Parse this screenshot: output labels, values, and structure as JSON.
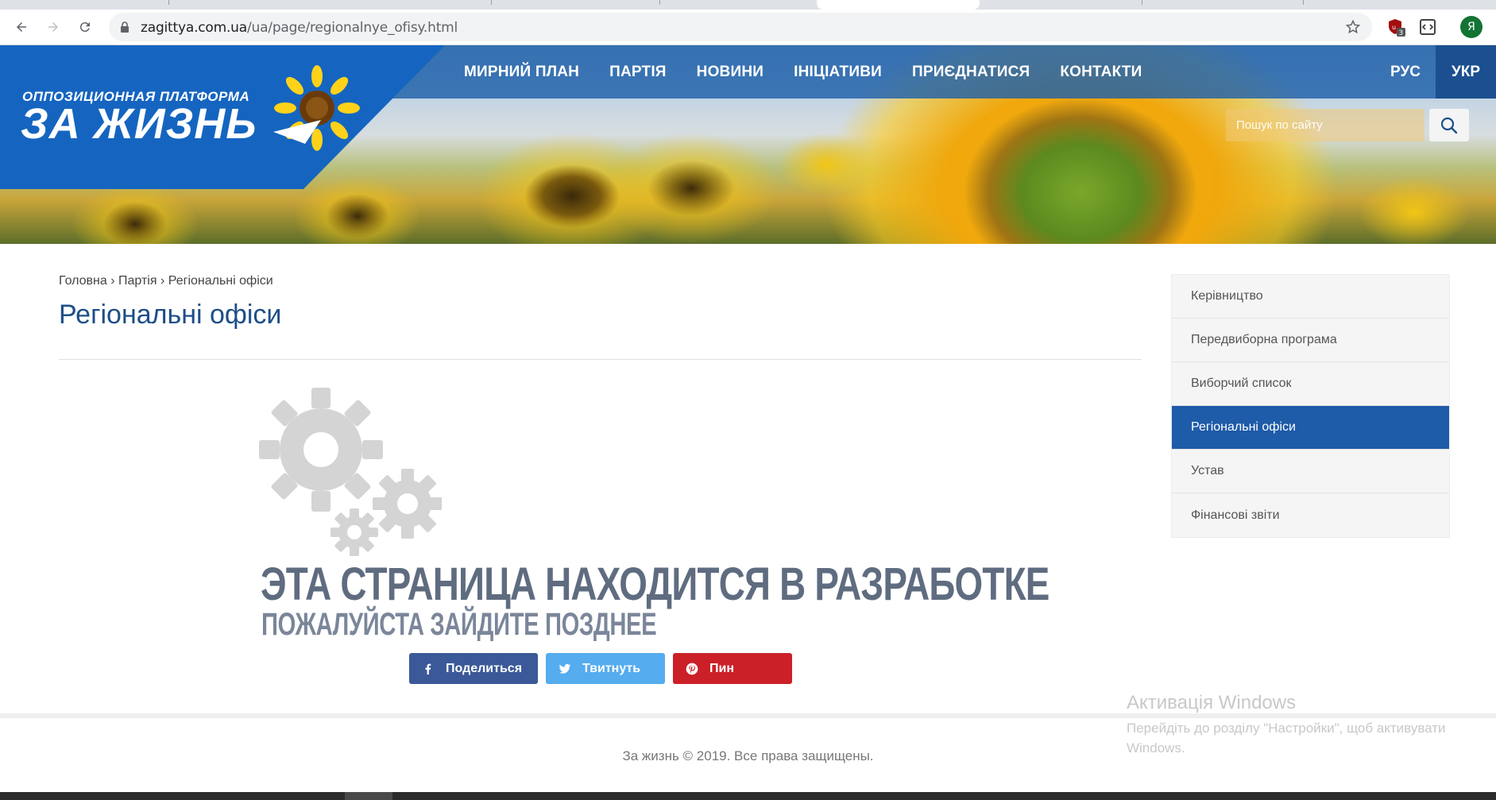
{
  "browser": {
    "url_host": "zagittya.com.ua",
    "url_path": "/ua/page/regionalnye_ofisy.html",
    "ext_badge": "3",
    "profile_initial": "Я"
  },
  "header": {
    "logo_top": "ОППОЗИЦИОННАЯ ПЛАТФОРМА",
    "logo_main": "ЗА ЖИЗНЬ",
    "nav": [
      "МИРНИЙ ПЛАН",
      "ПАРТІЯ",
      "НОВИНИ",
      "ІНІЦІАТИВИ",
      "ПРИЄДНАТИСЯ",
      "КОНТАКТИ"
    ],
    "lang_rus": "РУС",
    "lang_ukr": "УКР",
    "search_placeholder": "Пошук по сайту"
  },
  "breadcrumb": {
    "home": "Головна",
    "party": "Партія",
    "current": "Регіональні офіси",
    "sep": " › "
  },
  "page_title": "Регіональні офіси",
  "dev_notice": {
    "line1": "ЭТА СТРАНИЦА НАХОДИТСЯ В РАЗРАБОТКЕ",
    "line2": "ПОЖАЛУЙСТА ЗАЙДИТЕ ПОЗДНЕЕ"
  },
  "share": {
    "facebook": "Поделиться",
    "twitter": "Твитнуть",
    "pinterest": "Пин"
  },
  "sidebar": {
    "items": [
      {
        "label": "Керівництво",
        "active": false
      },
      {
        "label": "Передвиборна програма",
        "active": false
      },
      {
        "label": "Виборчий список",
        "active": false
      },
      {
        "label": "Регіональні офіси",
        "active": true
      },
      {
        "label": "Устав",
        "active": false
      },
      {
        "label": "Фінансові звіти",
        "active": false
      }
    ]
  },
  "footer": {
    "copyright": "За жизнь © 2019. Все права защищены."
  },
  "windows_watermark": {
    "title": "Активація Windows",
    "subtitle": "Перейдіть до розділу \"Настройки\", щоб активувати Windows."
  },
  "colors": {
    "brand_blue": "#1565c0",
    "active_item": "#1e5ba8",
    "title_blue": "#1d4e89",
    "facebook": "#3b5998",
    "twitter": "#55acee",
    "pinterest": "#cb2027"
  }
}
